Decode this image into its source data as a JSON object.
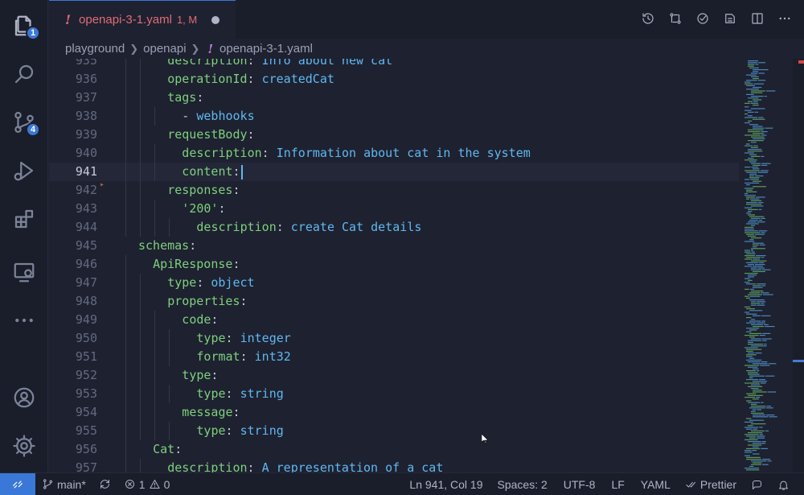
{
  "activity_bar": {
    "explorer_badge": "1",
    "source_control_badge": "4"
  },
  "tab": {
    "icon": "!",
    "filename": "openapi-3-1.yaml",
    "status": "1, M"
  },
  "breadcrumb": {
    "items": [
      "playground",
      "openapi"
    ],
    "file_icon": "!",
    "file": "openapi-3-1.yaml"
  },
  "editor": {
    "lines": [
      {
        "num": "935",
        "indent": 3,
        "key": "description",
        "value": " Info about new cat"
      },
      {
        "num": "936",
        "indent": 3,
        "key": "operationId",
        "value": " createdCat"
      },
      {
        "num": "937",
        "indent": 3,
        "key": "tags",
        "value": ""
      },
      {
        "num": "938",
        "indent": 4,
        "dash": "- ",
        "value": "webhooks"
      },
      {
        "num": "939",
        "indent": 3,
        "key": "requestBody",
        "value": ""
      },
      {
        "num": "940",
        "indent": 4,
        "key": "description",
        "value": " Information about cat in the system"
      },
      {
        "num": "941",
        "indent": 4,
        "key": "content",
        "value": "",
        "current": true
      },
      {
        "num": "942",
        "indent": 3,
        "key": "responses",
        "value": ""
      },
      {
        "num": "943",
        "indent": 4,
        "str": "'200'",
        "value": ""
      },
      {
        "num": "944",
        "indent": 5,
        "key": "description",
        "value": " create Cat details"
      },
      {
        "num": "945",
        "indent": 1,
        "key": "schemas",
        "value": ""
      },
      {
        "num": "946",
        "indent": 2,
        "key": "ApiResponse",
        "value": ""
      },
      {
        "num": "947",
        "indent": 3,
        "key": "type",
        "value": " object"
      },
      {
        "num": "948",
        "indent": 3,
        "key": "properties",
        "value": ""
      },
      {
        "num": "949",
        "indent": 4,
        "key": "code",
        "value": ""
      },
      {
        "num": "950",
        "indent": 5,
        "key": "type",
        "value": " integer"
      },
      {
        "num": "951",
        "indent": 5,
        "key": "format",
        "value": " int32"
      },
      {
        "num": "952",
        "indent": 4,
        "key": "type",
        "value": ""
      },
      {
        "num": "953",
        "indent": 5,
        "key": "type",
        "value": " string"
      },
      {
        "num": "954",
        "indent": 4,
        "key": "message",
        "value": ""
      },
      {
        "num": "955",
        "indent": 5,
        "key": "type",
        "value": " string"
      },
      {
        "num": "956",
        "indent": 2,
        "key": "Cat",
        "value": ""
      },
      {
        "num": "957",
        "indent": 3,
        "key": "description",
        "value": " A representation of a cat"
      }
    ]
  },
  "status_bar": {
    "branch": "main*",
    "errors": "1",
    "warnings": "0",
    "position": "Ln 941, Col 19",
    "spaces": "Spaces: 2",
    "encoding": "UTF-8",
    "eol": "LF",
    "language": "YAML",
    "formatter": "Prettier"
  },
  "colors": {
    "accent": "#3a78d8",
    "key": "#7ed07e",
    "value": "#5fb8f0",
    "modified": "#e06c75"
  }
}
